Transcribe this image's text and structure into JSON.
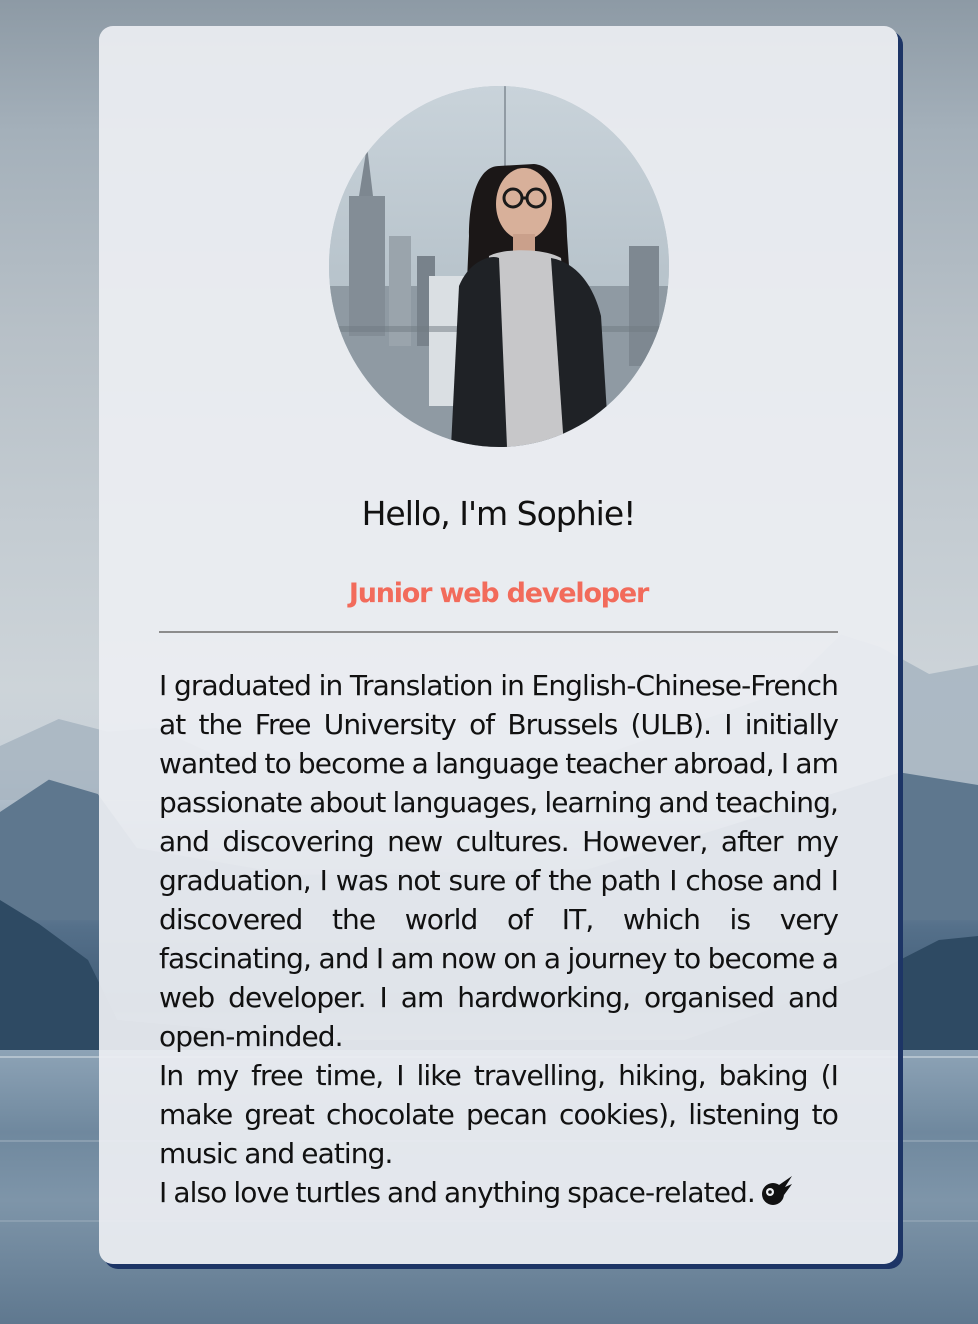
{
  "profile": {
    "greeting": "Hello, I'm Sophie!",
    "role": "Junior web developer",
    "avatar_icon": "profile-photo",
    "accent_color": "#f26b5b",
    "card_shadow_color": "#1d3566"
  },
  "bio": {
    "paragraph_1": "I graduated in Translation in English-Chinese-French at the Free University of Brussels (ULB). I initially wanted to become a language teacher abroad, I am passionate about languages, learning and teaching, and discovering new cultures. However, after my graduation, I was not sure of the path I chose and I discovered the world of IT, which is very fascinating, and I am now on a journey to become a web developer. I am hardworking, organised and open-minded.",
    "paragraph_2": "In my free time, I like travelling, hiking, baking (I make great chocolate pecan cookies), listening to music and eating.",
    "paragraph_3": "I also love turtles and anything space-related.",
    "trailing_icon": "comet-icon"
  }
}
